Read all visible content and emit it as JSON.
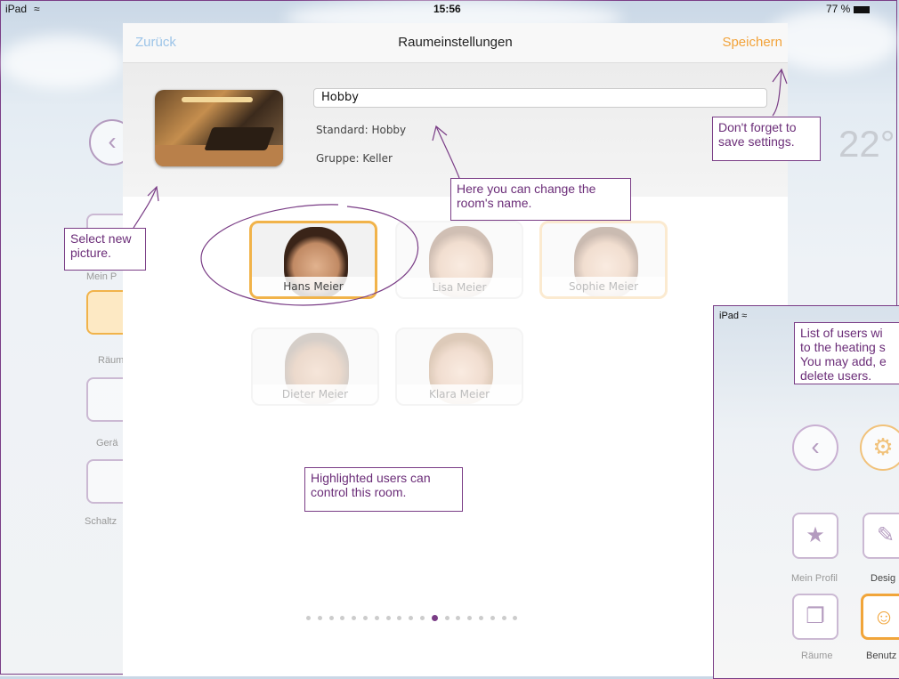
{
  "status": {
    "device": "iPad",
    "time": "15:56",
    "battery": "77 %"
  },
  "background": {
    "temperature": "22°",
    "labels": {
      "my_profile": "Mein P",
      "rooms": "Räum",
      "devices": "Gerä",
      "schedule": "Schaltz"
    }
  },
  "modal": {
    "back": "Zurück",
    "title": "Raumeinstellungen",
    "save": "Speichern",
    "room_name": "Hobby",
    "standard": "Standard: Hobby",
    "group": "Gruppe: Keller",
    "users": [
      {
        "name": "Hans Meier",
        "active": true
      },
      {
        "name": "Lisa Meier",
        "active": false
      },
      {
        "name": "Sophie Meier",
        "active": false
      },
      {
        "name": "Dieter Meier",
        "active": false
      },
      {
        "name": "Klara Meier",
        "active": false
      }
    ],
    "page_dots": {
      "count": 19,
      "current": 12
    }
  },
  "annotations": {
    "save": "Don't forget to\nsave settings.",
    "name": "Here you can change the\nroom's name.",
    "picture": "Select new\npicture.",
    "highlight": "Highlighted users can\ncontrol this room.",
    "users_list": "List of users wi\nto the heating s\nYou may add, e\ndelete users."
  },
  "inset": {
    "device": "iPad",
    "tiles": {
      "my_profile": "Mein Profil",
      "design": "Desig",
      "rooms": "Räume",
      "users": "Benutz"
    }
  },
  "colors": {
    "accent": "#f2a33a",
    "annotation": "#7a3d86",
    "back_link": "#9cc4e8"
  }
}
